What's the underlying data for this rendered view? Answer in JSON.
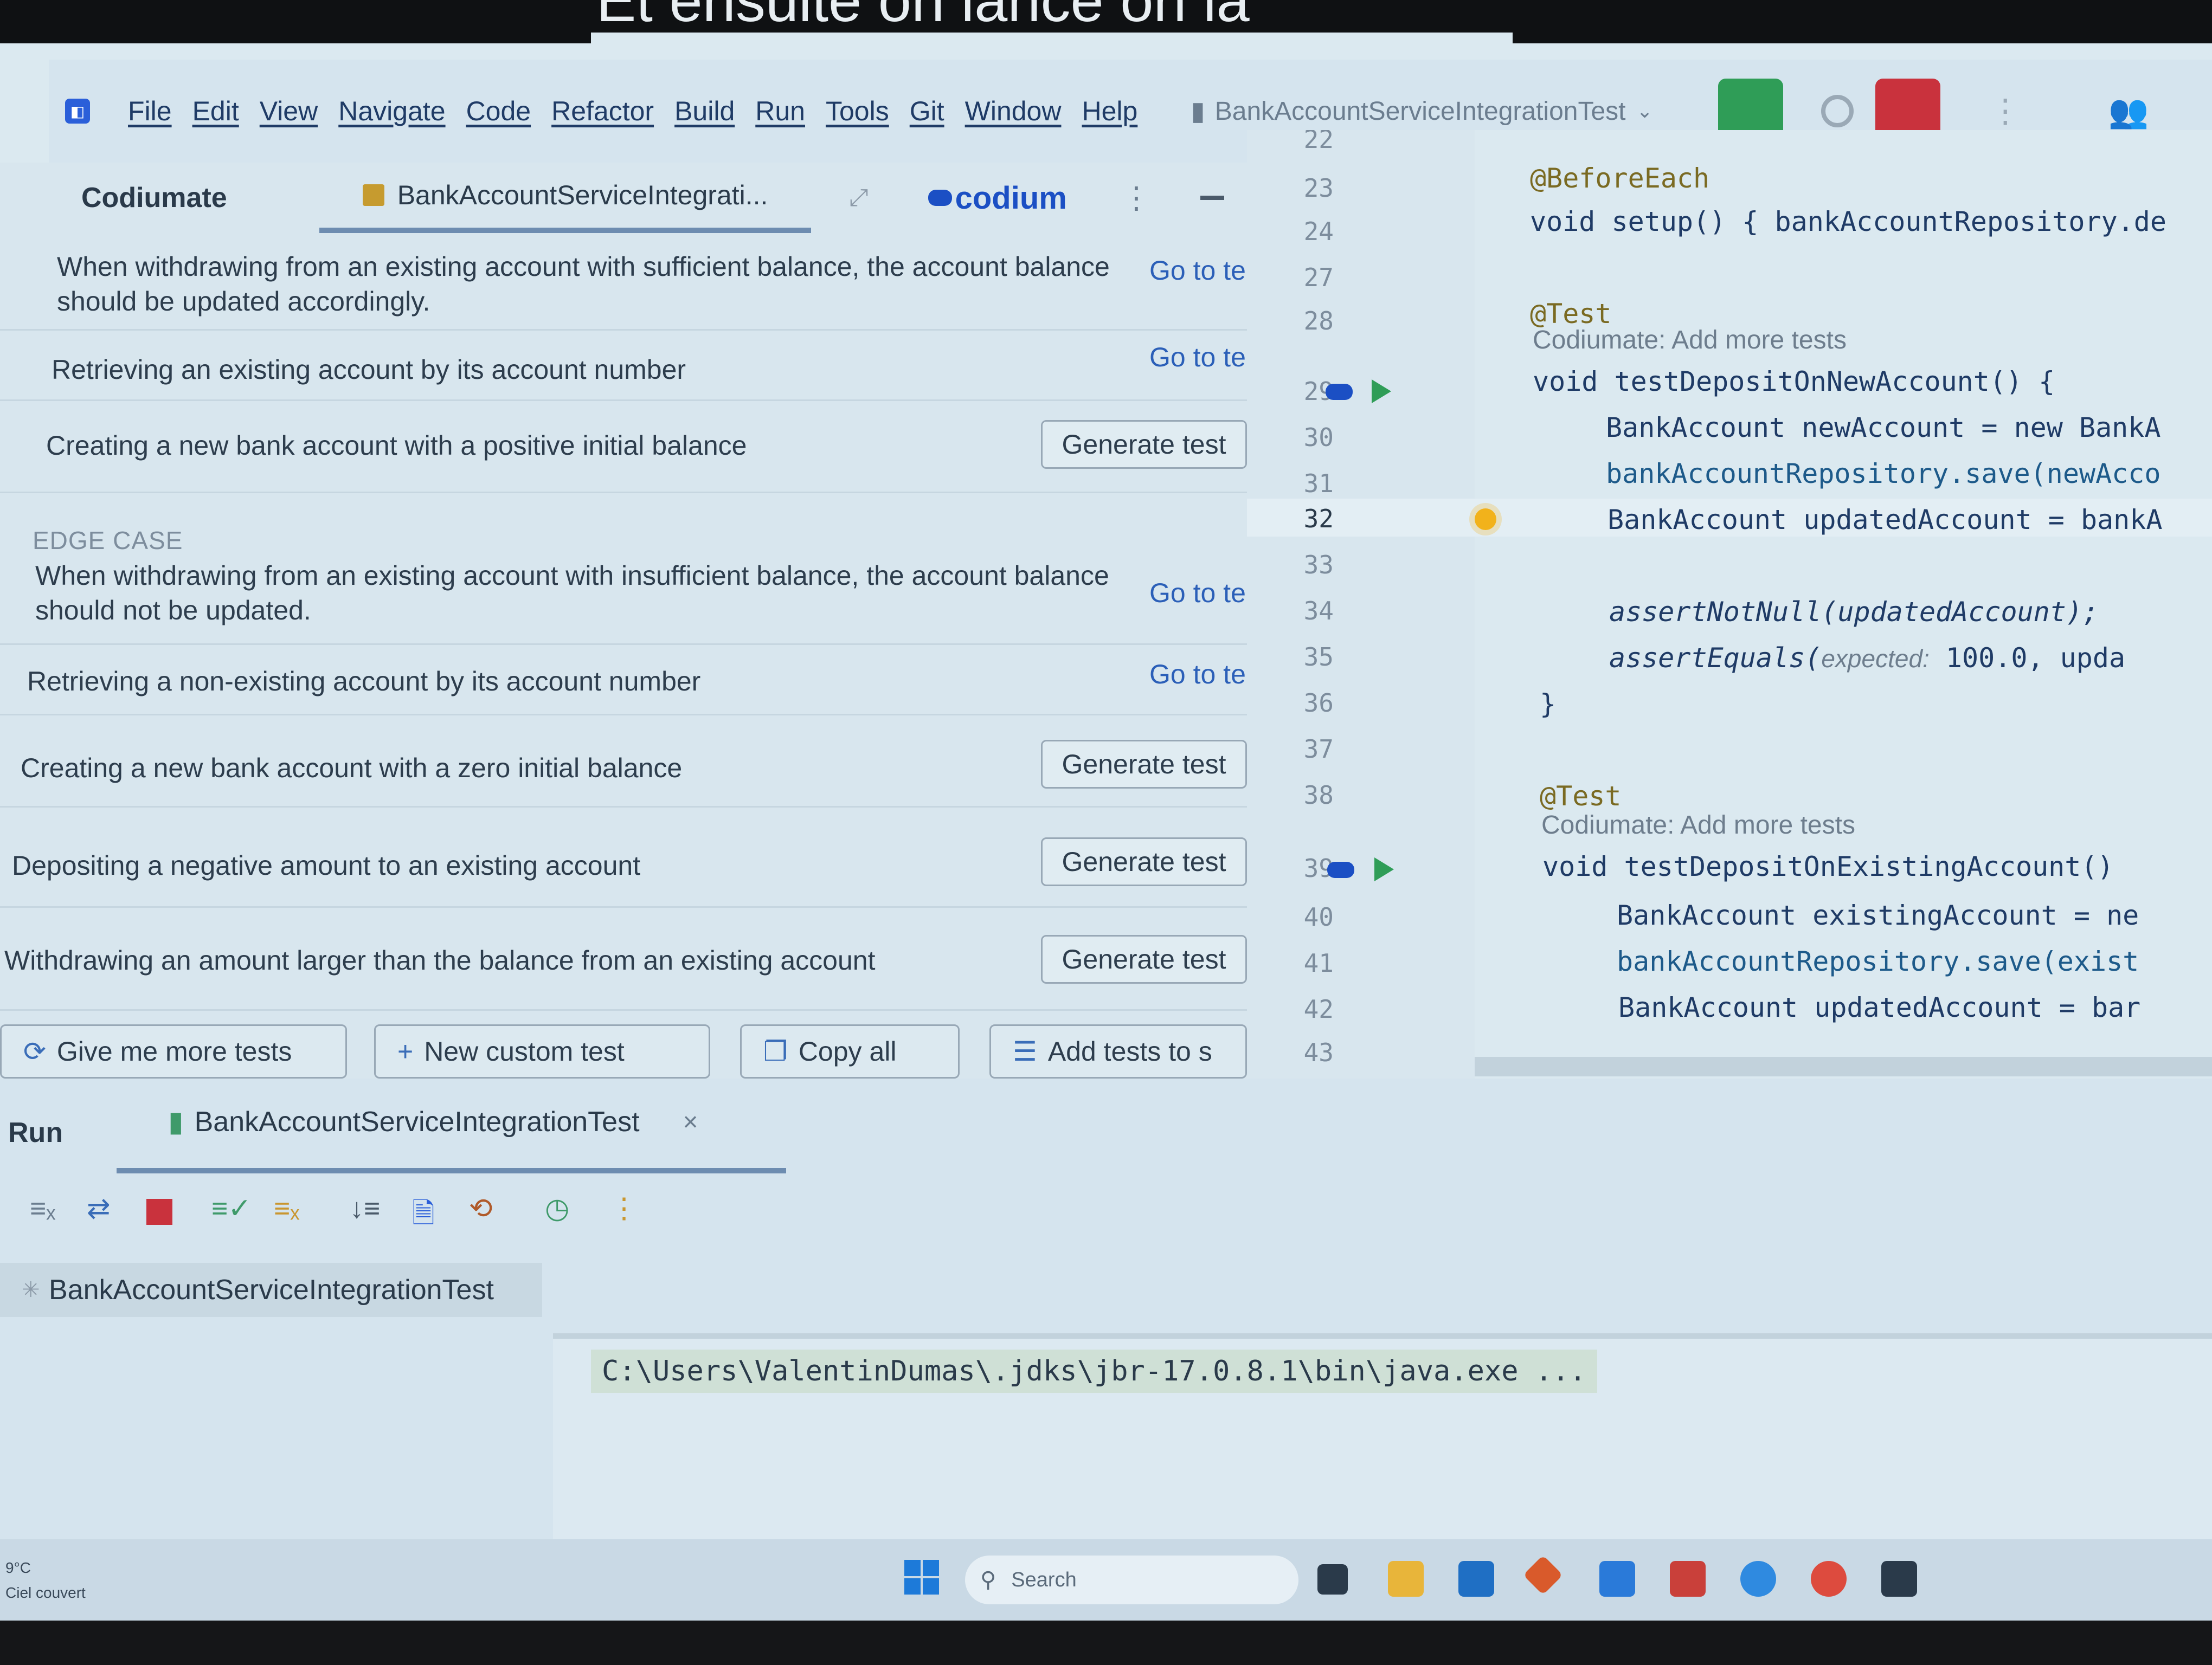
{
  "slide_title": "Et ensuite on lance on la",
  "menu": [
    "File",
    "Edit",
    "View",
    "Navigate",
    "Code",
    "Refactor",
    "Build",
    "Run",
    "Tools",
    "Git",
    "Window",
    "Help"
  ],
  "run_config": "BankAccountServiceIntegrationTest",
  "codiumate_panel": {
    "title": "Codiumate",
    "file_tab": "BankAccountServiceIntegrati...",
    "brand": "codium",
    "behaviors": [
      {
        "text": "When withdrawing from an existing account with sufficient balance, the account balance should be updated accordingly.",
        "action": "Go to te"
      },
      {
        "text": "Retrieving an existing account by its account number",
        "action": "Go to te"
      },
      {
        "text": "Creating a new bank account with a positive initial balance",
        "action": "Generate test"
      }
    ],
    "edge_case_label": "EDGE CASE",
    "edge_cases": [
      {
        "text": "When withdrawing from an existing account with insufficient balance, the account balance should not be updated.",
        "action": "Go to te"
      },
      {
        "text": "Retrieving a non-existing account by its account number",
        "action": "Go to te"
      },
      {
        "text": "Creating a new bank account with a zero initial balance",
        "action": "Generate test"
      },
      {
        "text": "Depositing a negative amount to an existing account",
        "action": "Generate test"
      },
      {
        "text": "Withdrawing an amount larger than the balance from an existing account",
        "action": "Generate test"
      }
    ],
    "actions": {
      "more_tests": "Give me more tests",
      "new_custom": "New custom test",
      "copy_all": "Copy all",
      "add_tests": "Add tests to s"
    }
  },
  "editor": {
    "line_numbers": [
      "22",
      "23",
      "24",
      "27",
      "28",
      "29",
      "30",
      "31",
      "32",
      "33",
      "34",
      "35",
      "36",
      "37",
      "38",
      "39",
      "40",
      "41",
      "42",
      "43"
    ],
    "lens": "Codiumate: Add more tests",
    "code": {
      "l23": "@BeforeEach",
      "l24": "void setup() { bankAccountRepository.de",
      "l28": "@Test",
      "l29": "void testDepositOnNewAccount() {",
      "l30": "BankAccount newAccount = new BankA",
      "l31": "bankAccountRepository.save(newAcco",
      "l32": "BankAccount updatedAccount = bankA",
      "l34": "assertNotNull(updatedAccount);",
      "l35a": "assertEquals(",
      "l35hint": "expected:",
      "l35b": " 100.0, upda",
      "l36": "}",
      "l38": "@Test",
      "l39": "void testDepositOnExistingAccount()",
      "l40": "BankAccount existingAccount = ne",
      "l41": "bankAccountRepository.save(exist",
      "l42": "BankAccount updatedAccount = bar"
    }
  },
  "run_panel": {
    "title": "Run",
    "tab": "BankAccountServiceIntegrationTest",
    "tree_item": "BankAccountServiceIntegrationTest",
    "console": "C:\\Users\\ValentinDumas\\.jdks\\jbr-17.0.8.1\\bin\\java.exe ..."
  },
  "taskbar": {
    "temp": "9°C",
    "weather": "Ciel couvert",
    "search_placeholder": "Search"
  }
}
